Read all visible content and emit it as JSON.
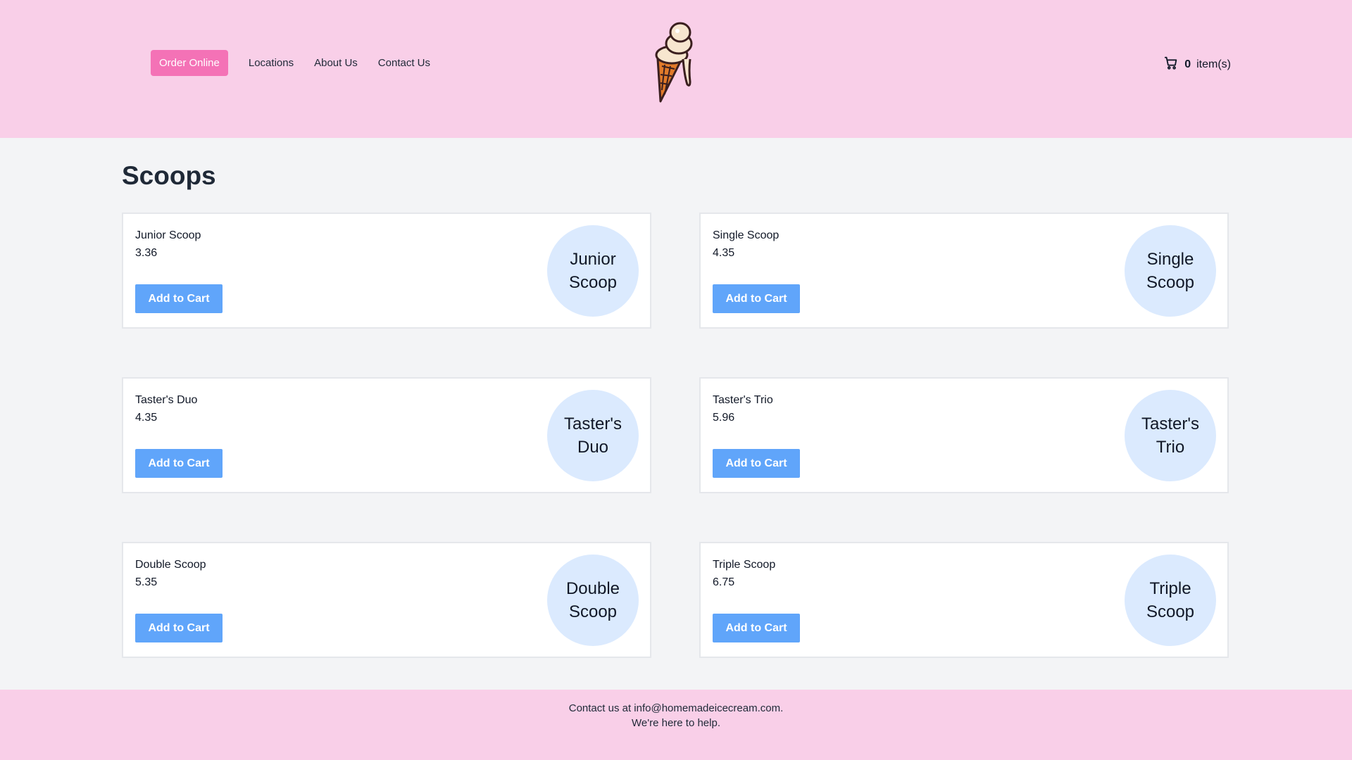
{
  "nav": {
    "order_online": "Order Online",
    "locations": "Locations",
    "about_us": "About Us",
    "contact_us": "Contact Us"
  },
  "logo": {
    "icon": "ice-cream-cone-icon"
  },
  "cart": {
    "icon": "shopping-cart-icon",
    "count": "0",
    "label": "item(s)"
  },
  "main": {
    "title": "Scoops"
  },
  "products": [
    {
      "name": "Junior Scoop",
      "price": "3.36",
      "button": "Add to Cart",
      "badge": "Junior Scoop"
    },
    {
      "name": "Single Scoop",
      "price": "4.35",
      "button": "Add to Cart",
      "badge": "Single Scoop"
    },
    {
      "name": "Taster's Duo",
      "price": "4.35",
      "button": "Add to Cart",
      "badge": "Taster's Duo"
    },
    {
      "name": "Taster's Trio",
      "price": "5.96",
      "button": "Add to Cart",
      "badge": "Taster's Trio"
    },
    {
      "name": "Double Scoop",
      "price": "5.35",
      "button": "Add to Cart",
      "badge": "Double Scoop"
    },
    {
      "name": "Triple Scoop",
      "price": "6.75",
      "button": "Add to Cart",
      "badge": "Triple Scoop"
    }
  ],
  "footer": {
    "line1": "Contact us at info@homemadeicecream.com.",
    "line2": "We're here to help."
  },
  "colors": {
    "header_bg": "#f9cfe8",
    "accent_pink": "#f472b6",
    "button_blue": "#60a5fa",
    "badge_blue": "#dbeafe",
    "page_bg": "#f3f4f6"
  }
}
